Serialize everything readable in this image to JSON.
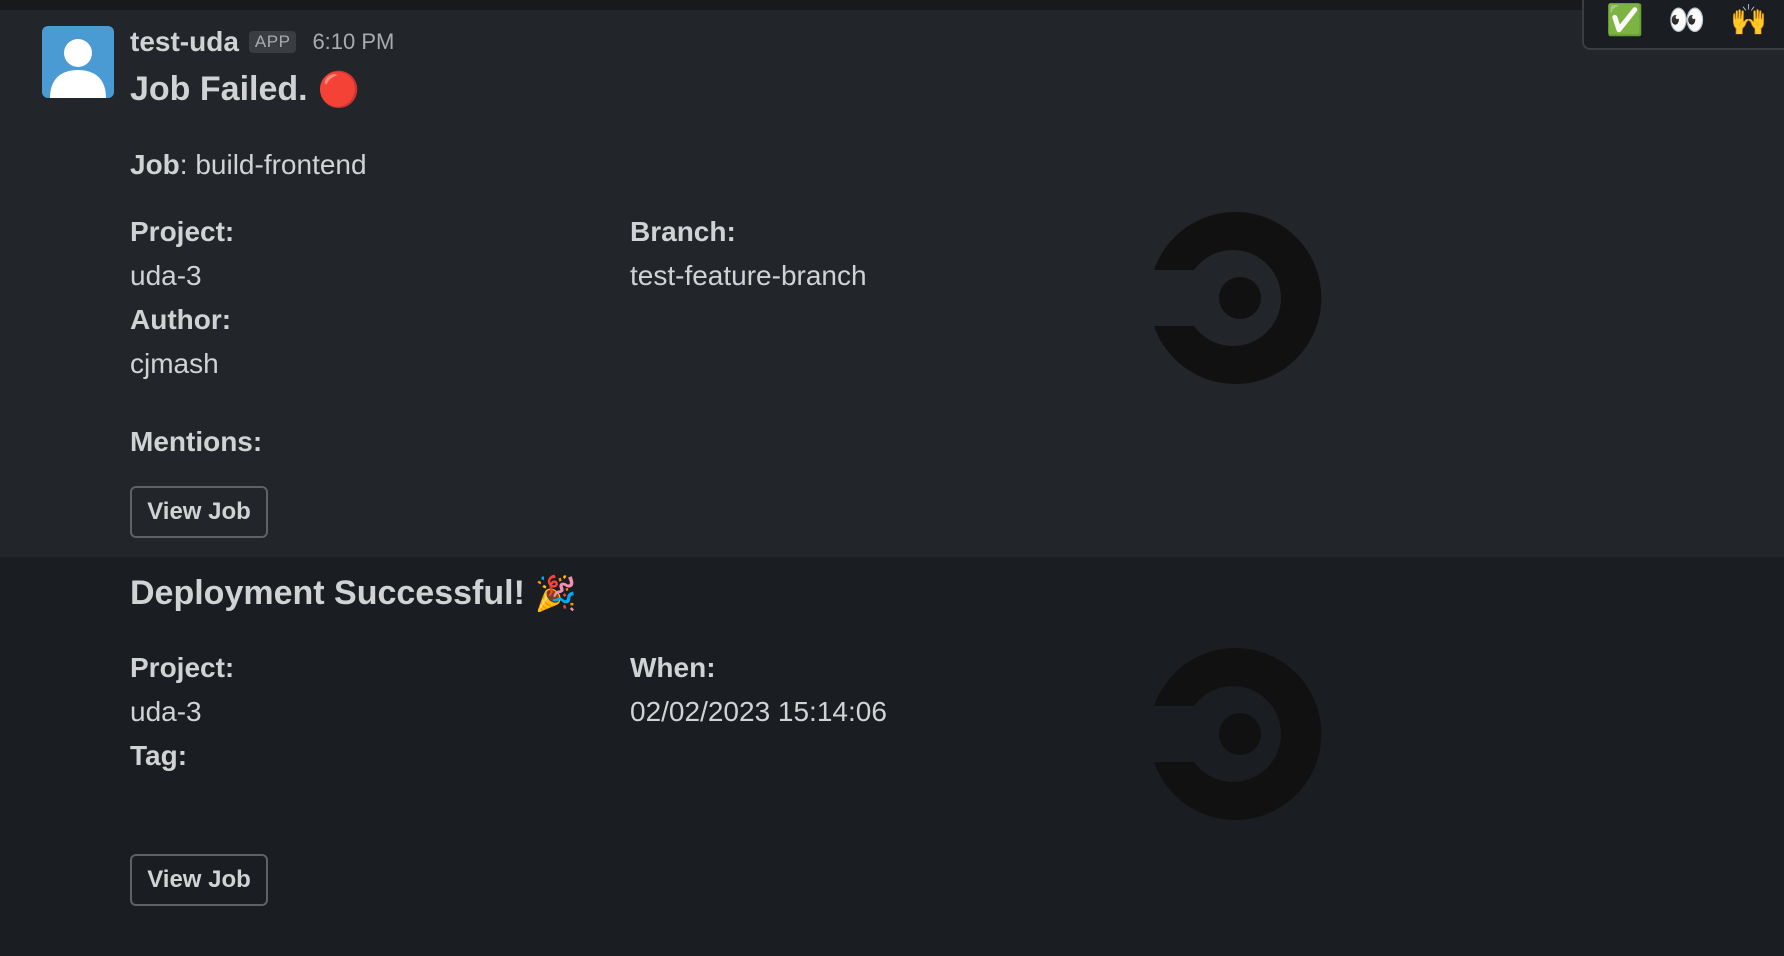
{
  "message": {
    "sender": "test-uda",
    "app_badge": "APP",
    "timestamp": "6:10 PM"
  },
  "reactions": [
    "✅",
    "👀",
    "🙌"
  ],
  "job_failed": {
    "title": "Job Failed.",
    "title_emoji": "🔴",
    "job_label": "Job",
    "job_value": ": build-frontend",
    "project_label": "Project:",
    "project_value": "uda-3",
    "branch_label": "Branch:",
    "branch_value": "test-feature-branch",
    "author_label": "Author:",
    "author_value": "cjmash",
    "mentions_label": "Mentions:",
    "button_label": "View Job"
  },
  "deployment": {
    "title": "Deployment Successful!",
    "title_emoji": "🎉",
    "project_label": "Project:",
    "project_value": "uda-3",
    "when_label": "When:",
    "when_value": "02/02/2023 15:14:06",
    "tag_label": "Tag:",
    "button_label": "View Job"
  },
  "colors": {
    "background": "#1a1d21",
    "hover_background": "#222529",
    "text": "#d1d2d3",
    "avatar": "#4a9ad4",
    "logo": "#111111"
  }
}
